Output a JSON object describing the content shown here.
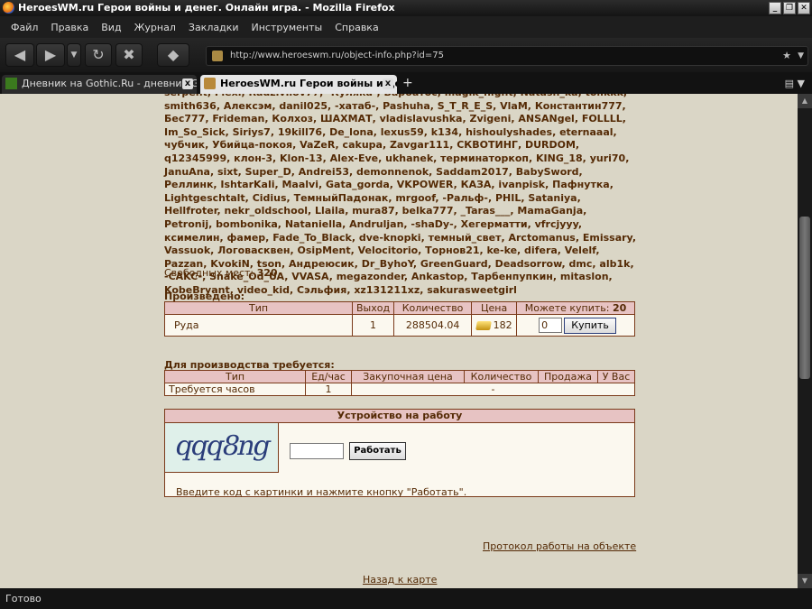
{
  "window": {
    "title": "HeroesWM.ru Герои войны и денег. Онлайн игра. - Mozilla Firefox",
    "buttons": [
      "_",
      "❐",
      "✕"
    ]
  },
  "menu": [
    "Файл",
    "Правка",
    "Вид",
    "Журнал",
    "Закладки",
    "Инструменты",
    "Справка"
  ],
  "nav": {
    "url": "http://www.heroeswm.ru/object-info.php?id=75"
  },
  "tabs": [
    {
      "label": "Дневник на Gothic.Ru - дневник Ghost...",
      "active": false
    },
    {
      "label": "HeroesWM.ru Герои войны и де...",
      "active": true
    }
  ],
  "page": {
    "workers_text": "serpent, Flexi, Radzivilov77, -Куляка-, Барбатос, magik_night, Natash_ka, tolikkk, smith636, Алексэм, danil025, -хатаб-, Pashuha, S_T_R_E_S, VlaM, Константин777, Бес777, Frideman, Колхоз, ШАХМАТ, vladislavushka, Zvigeni, ANSANgel, FOLLLL, Im_So_Sick, Siriys7, 19kill76, De_lona, lexus59, k134, hishoulyshades, eternaaal, чубчик, Убийца-покоя, VaZeR, cakupa, Zavgar111, СКВОТИНГ, DURDOM, q12345999, клон-3, Klon-13, Alex-Eve, ukhanek, терминаторкоп, KING_18, yuri70, JanuAna, sixt, Super_D, Andrei53, demonnenok, Saddam2017, BabySword, Реллинк, IshtarKali, Maalvi, Gata_gorda, VKPOWER, КАЗА, ivanpisk, Пафнутка, Lightgeschtalt, Cidius, ТемныйПадонак, mrgoof, -Ральф-, PHIL, Sataniya, Hellfroter, nekr_oldschool, Llaila, mura87, belka777, _Taras___, MamaGanja, Petronij, bombonika, Nataniella, Andruljan, -shaDy-, Хегерматти, vfrcjyyy, ксимелин, фамер, Fade_To_Black, dve-knopki, темный_свет, Arctomanus, Emissary, Vassuok, Логовасквен, OsipMent, Velocitorio, Торнов21, ke-ke, difera, Velelf, Pazzan, KvokiN, tson, Андреюсик, Dr_ByhoY, GreenGuard, Deadsorrow, dmc, alb1k, -CAKC-, Snake_Od_UA, VVASA, megazonder, Ankastop, Тарбенпупкин, mitaslon, KobeBryant, video_kid, Сэльфия, xz131211xz, sakurasweetgirl",
    "free_label": "Свободных мест:",
    "free_value": "320",
    "produced": {
      "title": "Произведено:",
      "headers": [
        "Тип",
        "Выход",
        "Количество",
        "Цена",
        "Можете купить:"
      ],
      "can_buy": "20",
      "row": {
        "type": "Руда",
        "output": "1",
        "quantity": "288504.04",
        "price": "182",
        "input_value": "0",
        "buy_label": "Купить"
      }
    },
    "required": {
      "title": "Для производства требуется:",
      "headers": [
        "Тип",
        "Ед/час",
        "Закупочная цена",
        "Количество",
        "Продажа",
        "У Вас"
      ],
      "row": {
        "type": "Требуется часов",
        "per_hour": "1",
        "rest": "-"
      }
    },
    "job": {
      "title": "Устройство на работу",
      "captcha": "qqq8ng",
      "work_label": "Работать",
      "hint": "Введите код с картинки и нажмите кнопку \"Работать\"."
    },
    "log_link": "Протокол работы на объекте",
    "back_link": "Назад к карте"
  },
  "status": "Готово"
}
